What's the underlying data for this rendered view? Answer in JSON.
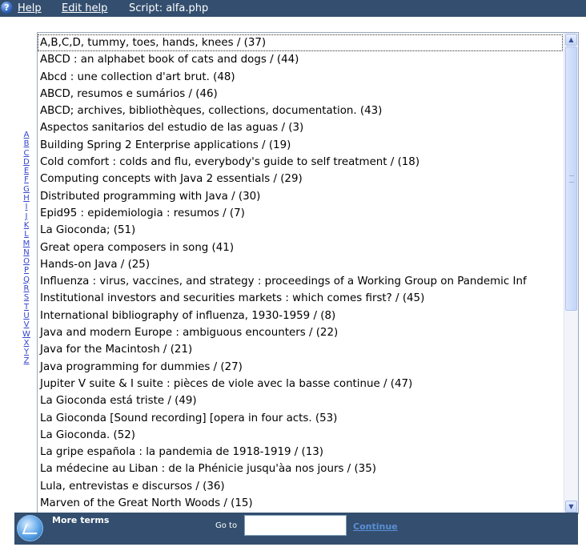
{
  "topbar": {
    "help_label": "Help",
    "edit_help_label": "Edit help",
    "script_label": "Script: alfa.php"
  },
  "alphabet": [
    "A",
    "B",
    "C",
    "D",
    "E",
    "F",
    "G",
    "H",
    "I",
    "J",
    "K",
    "L",
    "M",
    "N",
    "O",
    "P",
    "Q",
    "R",
    "S",
    "T",
    "U",
    "V",
    "W",
    "X",
    "Y",
    "Z"
  ],
  "list": {
    "items": [
      "A,B,C,D, tummy, toes, hands, knees / (37)",
      "ABCD : an alphabet book of cats and dogs / (44)",
      "Abcd : une collection d'art brut. (48)",
      "ABCD, resumos e sumários / (46)",
      "ABCD; archives, bibliothèques, collections, documentation. (43)",
      "Aspectos sanitarios del estudio de las aguas / (3)",
      "Building Spring 2 Enterprise applications / (19)",
      "Cold comfort : colds and flu, everybody's guide to self treatment / (18)",
      "Computing concepts with Java 2 essentials / (29)",
      "Distributed programming with Java / (30)",
      "Epid95 : epidemiologia : resumos / (7)",
      "La Gioconda; (51)",
      "Great opera composers in song (41)",
      "Hands-on Java / (25)",
      "Influenza : virus, vaccines, and strategy : proceedings of a Working Group on Pandemic Inf",
      "Institutional investors and securities markets : which comes first? / (45)",
      "International bibliography of influenza, 1930-1959 / (8)",
      "Java and modern Europe : ambiguous encounters / (22)",
      "Java for the Macintosh / (21)",
      "Java programming for dummies / (27)",
      "Jupiter V suite & I suite : pièces de viole avec la basse continue / (47)",
      "La Gioconda está triste / (49)",
      "La Gioconda [Sound recording] [opera in four acts. (53)",
      "La Gioconda. (52)",
      "La gripe española : la pandemia de 1918-1919 / (13)",
      "La médecine au Liban : de la Phénicie jusqu'àa nos jours / (35)",
      "Lula, entrevistas e discursos / (36)",
      "Marven of the Great North Woods / (15)"
    ]
  },
  "bottombar": {
    "more_terms_label": "More terms",
    "goto_label": "Go to",
    "goto_value": "",
    "continue_label": "Continue"
  }
}
